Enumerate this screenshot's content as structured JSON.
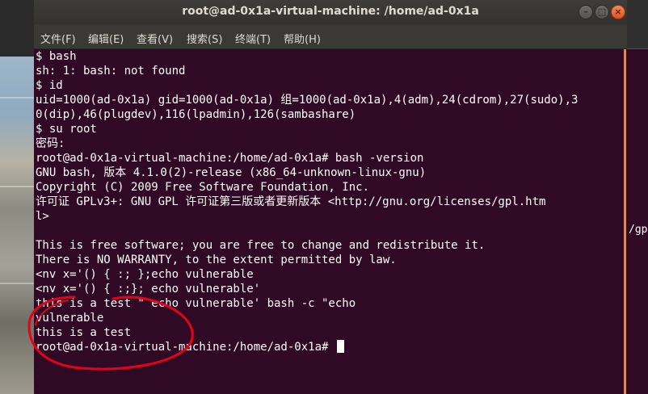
{
  "window": {
    "title": "root@ad-0x1a-virtual-machine: /home/ad-0x1a",
    "buttons": {
      "minimize": "–",
      "maximize": "□",
      "close": "×"
    }
  },
  "menu": {
    "items": [
      "文件(F)",
      "编辑(E)",
      "查看(V)",
      "搜索(S)",
      "终端(T)",
      "帮助(H)"
    ]
  },
  "terminal": {
    "lines": [
      "$ bash",
      "sh: 1: bash: not found",
      "$ id",
      "uid=1000(ad-0x1a) gid=1000(ad-0x1a) 组=1000(ad-0x1a),4(adm),24(cdrom),27(sudo),3",
      "0(dip),46(plugdev),116(lpadmin),126(sambashare)",
      "$ su root",
      "密码:",
      "root@ad-0x1a-virtual-machine:/home/ad-0x1a# bash -version",
      "GNU bash, 版本 4.1.0(2)-release (x86_64-unknown-linux-gnu)",
      "Copyright (C) 2009 Free Software Foundation, Inc.",
      "许可证 GPLv3+: GNU GPL 许可证第三版或者更新版本 <http://gnu.org/licenses/gpl.htm",
      "l>",
      "",
      "This is free software; you are free to change and redistribute it.",
      "There is NO WARRANTY, to the extent permitted by law.",
      "<nv x='() { :; };echo vulnerable",
      "<nv x='() { :;}; echo vulnerable'",
      "this is a test \" echo vulnerable' bash -c \"echo",
      "vulnerable",
      "this is a test",
      "root@ad-0x1a-virtual-machine:/home/ad-0x1a# "
    ]
  },
  "background_window": {
    "visible_text": "/gp"
  },
  "colors": {
    "terminal_bg": "#300a24",
    "text": "#ffffff",
    "titlebar": "#3c3b37",
    "close_button": "#e95420",
    "annotation": "#e8001a"
  }
}
